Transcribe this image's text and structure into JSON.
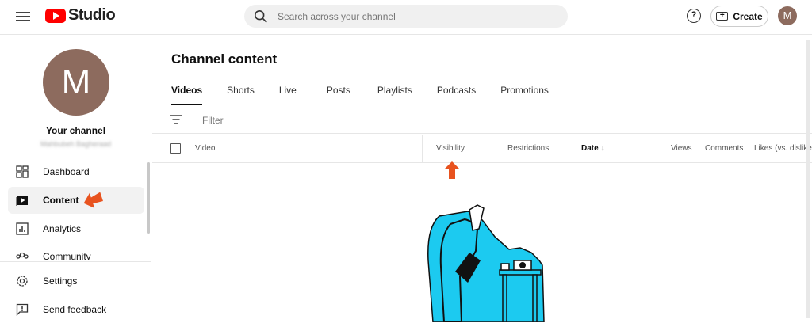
{
  "topbar": {
    "logo_text": "Studio",
    "search_placeholder": "Search across your channel",
    "help_label": "?",
    "create_label": "Create",
    "avatar_letter": "M"
  },
  "sidebar": {
    "avatar_letter": "M",
    "your_channel": "Your channel",
    "channel_handle": "Mahbubeh Bagheraad",
    "items": [
      {
        "label": "Dashboard",
        "icon": "dashboard-icon"
      },
      {
        "label": "Content",
        "icon": "content-icon",
        "active": true
      },
      {
        "label": "Analytics",
        "icon": "analytics-icon"
      },
      {
        "label": "Community",
        "icon": "community-icon"
      }
    ],
    "bottom_items": [
      {
        "label": "Settings",
        "icon": "gear-icon"
      },
      {
        "label": "Send feedback",
        "icon": "feedback-icon"
      }
    ]
  },
  "main": {
    "title": "Channel content",
    "tabs": [
      {
        "label": "Videos",
        "active": true
      },
      {
        "label": "Shorts"
      },
      {
        "label": "Live"
      },
      {
        "label": "Posts"
      },
      {
        "label": "Playlists"
      },
      {
        "label": "Podcasts"
      },
      {
        "label": "Promotions"
      }
    ],
    "filter_label": "Filter",
    "columns": {
      "video": "Video",
      "visibility": "Visibility",
      "restrictions": "Restrictions",
      "date": "Date",
      "views": "Views",
      "comments": "Comments",
      "likes": "Likes (vs. dislike"
    }
  },
  "colors": {
    "accent_red": "#ff0000",
    "annotation_arrow": "#e8531f",
    "illustration_cyan": "#1ccaf0",
    "avatar_bg": "#8d6b5e"
  }
}
